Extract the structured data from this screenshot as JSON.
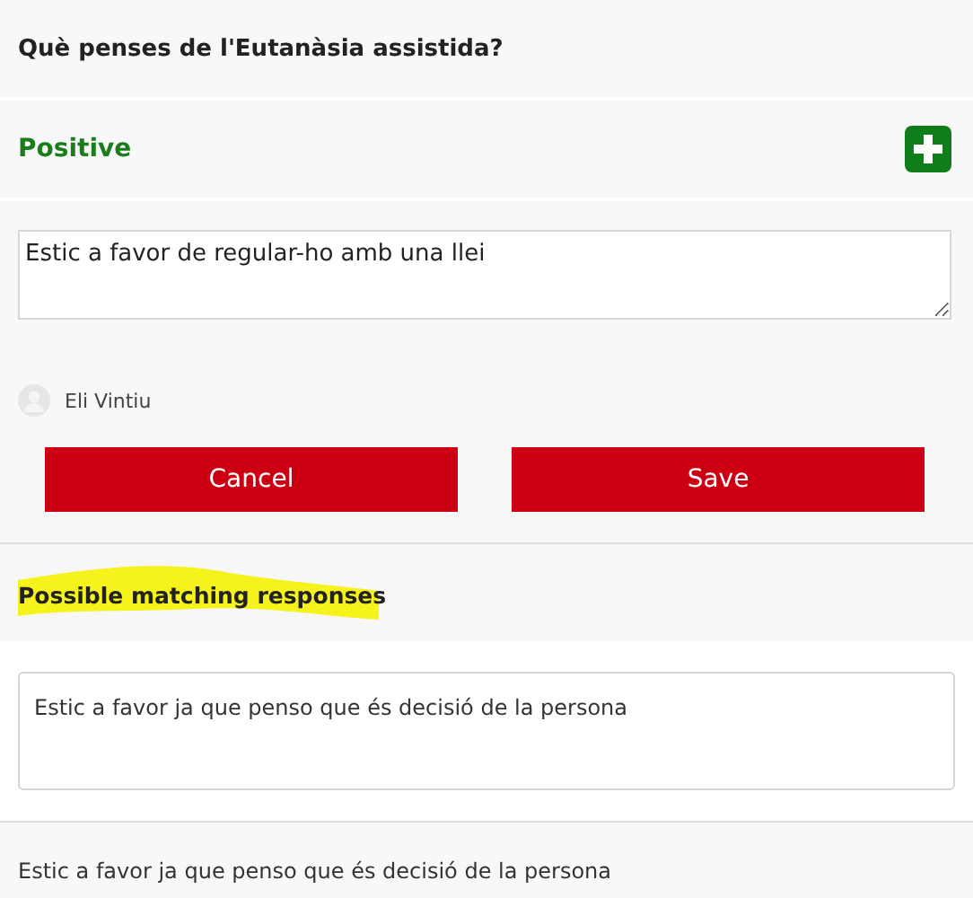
{
  "question": "Què penses de l'Eutanàsia assistida?",
  "category": {
    "label": "Positive"
  },
  "answer": {
    "value": "Estic a favor de regular-ho amb una llei "
  },
  "author": {
    "name": "Eli Vintiu"
  },
  "buttons": [
    {
      "label": "Cancel"
    },
    {
      "label": "Save"
    }
  ],
  "matches": {
    "heading": "Possible matching responses",
    "highlighted": true,
    "items": [
      {
        "kind": "box",
        "text": "Estic a favor ja que penso que és decisió de la persona"
      },
      {
        "kind": "plain",
        "text": "Estic a favor ja que penso que és decisió de la persona"
      }
    ]
  }
}
